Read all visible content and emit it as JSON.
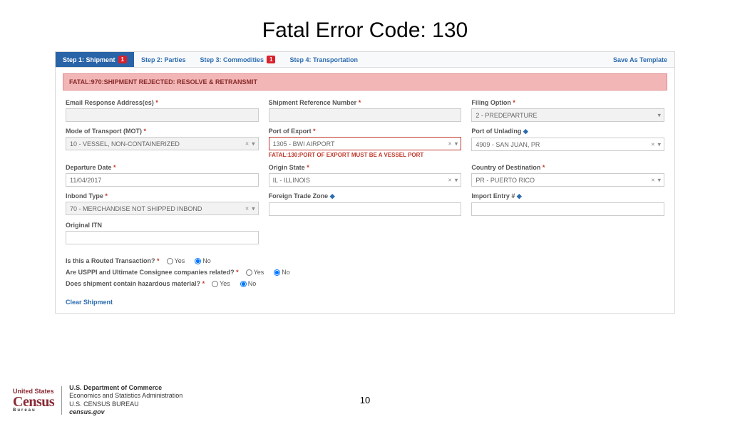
{
  "slide_title": "Fatal Error Code: 130",
  "tabs": {
    "t1": "Step 1: Shipment",
    "t1_badge": "1",
    "t2": "Step 2: Parties",
    "t3": "Step 3: Commodities",
    "t3_badge": "1",
    "t4": "Step 4: Transportation",
    "save": "Save As Template"
  },
  "alert": "FATAL:970:SHIPMENT REJECTED: RESOLVE & RETRANSMIT",
  "fields": {
    "email_label": "Email Response Address(es)",
    "shipref_label": "Shipment Reference Number",
    "filing_label": "Filing Option",
    "filing_value": "2 - PREDEPARTURE",
    "mot_label": "Mode of Transport (MOT)",
    "mot_value": "10 - VESSEL, NON-CONTAINERIZED",
    "poe_label": "Port of Export",
    "poe_value": "1305 - BWI AIRPORT",
    "poe_error": "FATAL:130:PORT OF EXPORT MUST BE A VESSEL PORT",
    "pou_label": "Port of Unlading",
    "pou_value": "4909 - SAN JUAN, PR",
    "dep_label": "Departure Date",
    "dep_value": "11/04/2017",
    "origin_label": "Origin State",
    "origin_value": "IL - ILLINOIS",
    "dest_label": "Country of Destination",
    "dest_value": "PR - PUERTO RICO",
    "inbond_label": "Inbond Type",
    "inbond_value": "70 - MERCHANDISE NOT SHIPPED INBOND",
    "ftz_label": "Foreign Trade Zone",
    "import_label": "Import Entry #",
    "itn_label": "Original ITN"
  },
  "questions": {
    "routed": "Is this a Routed Transaction?",
    "related": "Are USPPI and Ultimate Consignee companies related?",
    "hazmat": "Does shipment contain hazardous material?",
    "yes": "Yes",
    "no": "No"
  },
  "clear_link": "Clear Shipment",
  "footer": {
    "us": "United States",
    "census": "Census",
    "bureau": "Bureau",
    "dept": "U.S. Department of Commerce",
    "esa": "Economics and Statistics Administration",
    "uscb": "U.S. CENSUS BUREAU",
    "site": "census.gov"
  },
  "page_number": "10"
}
